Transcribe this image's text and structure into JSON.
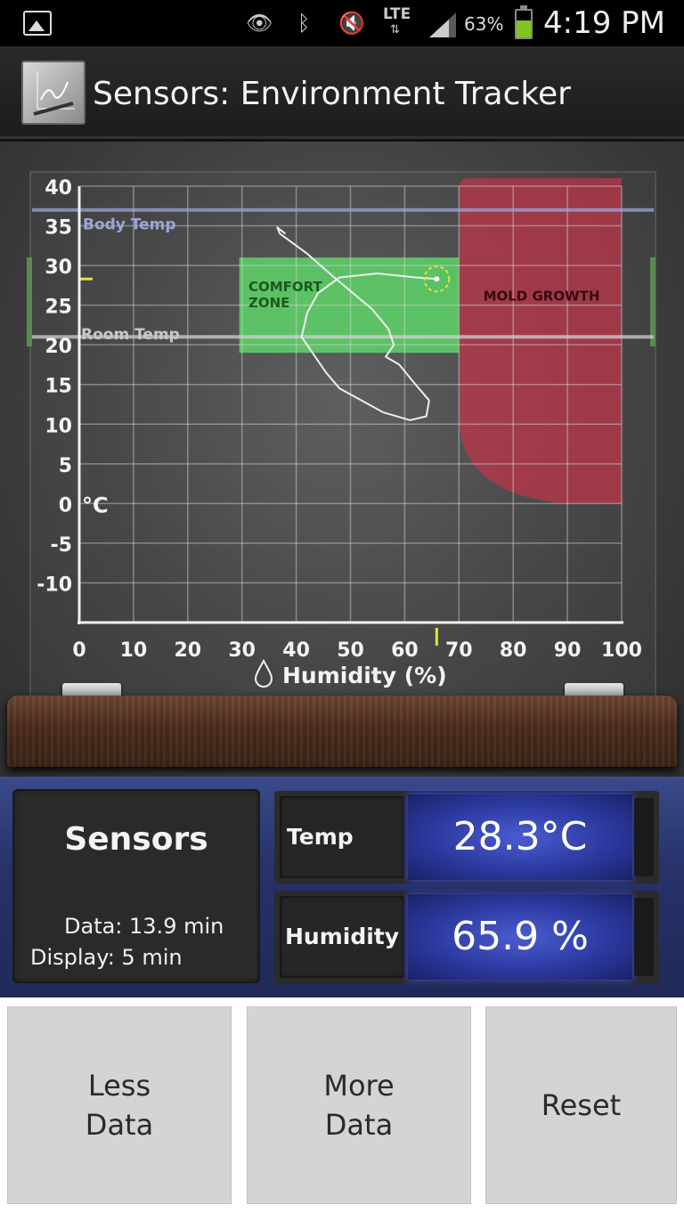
{
  "status_bar": {
    "battery_percent": "63%",
    "network": "LTE",
    "time": "4:19 PM",
    "icons": [
      "gallery-icon",
      "eye-icon",
      "bluetooth-icon",
      "mute-icon",
      "lte-icon",
      "signal-icon",
      "battery-icon"
    ]
  },
  "app": {
    "title": "Sensors: Environment Tracker",
    "icon": "app-chart-icon"
  },
  "chart_data": {
    "type": "line",
    "x_label": "Humidity (%)",
    "y_unit": "°C",
    "xlim": [
      0,
      100
    ],
    "ylim": [
      -15,
      40
    ],
    "x_ticks": [
      "0",
      "10",
      "20",
      "30",
      "40",
      "50",
      "60",
      "70",
      "80",
      "90",
      "100"
    ],
    "y_ticks": [
      "40",
      "35",
      "30",
      "25",
      "20",
      "15",
      "10",
      "5",
      "0",
      "-5",
      "-10"
    ],
    "grid": true,
    "reference_lines": [
      {
        "label": "Body Temp",
        "y": 37,
        "color": "#9aa6d8"
      },
      {
        "label": "Room Temp",
        "y": 21,
        "color": "#d0d0d0"
      }
    ],
    "zones": [
      {
        "label": "COMFORT ZONE",
        "x": [
          29.5,
          70
        ],
        "y": [
          19,
          31
        ],
        "color": "#5fe06a"
      },
      {
        "label": "MOLD GROWTH",
        "x": [
          70,
          100
        ],
        "y": [
          0,
          41
        ],
        "color": "#c0344a"
      }
    ],
    "trace": {
      "x": [
        38,
        36.5,
        37,
        39,
        42,
        47,
        54,
        57,
        58,
        56.5,
        59,
        62,
        64.5,
        64,
        61,
        56,
        52,
        48,
        45.5,
        43,
        41,
        42,
        44,
        48,
        55,
        62,
        66
      ],
      "y": [
        34,
        34.8,
        34,
        33,
        31.5,
        28.5,
        24.5,
        22,
        20,
        18.5,
        17.5,
        15,
        13,
        11,
        10.5,
        11.5,
        13,
        14.5,
        16.5,
        19,
        21,
        24,
        26.5,
        28.5,
        29,
        28.5,
        28.3
      ]
    },
    "current": {
      "humidity": 65.9,
      "temp": 28.3
    }
  },
  "panel": {
    "title": "Sensors",
    "data_line": "Data: 13.9 min",
    "display_line": "Display: 5 min",
    "temp_label": "Temp",
    "temp_value": "28.3°C",
    "humidity_label": "Humidity",
    "humidity_value": "65.9 %"
  },
  "buttons": {
    "less": "Less\nData",
    "more": "More\nData",
    "reset": "Reset"
  }
}
